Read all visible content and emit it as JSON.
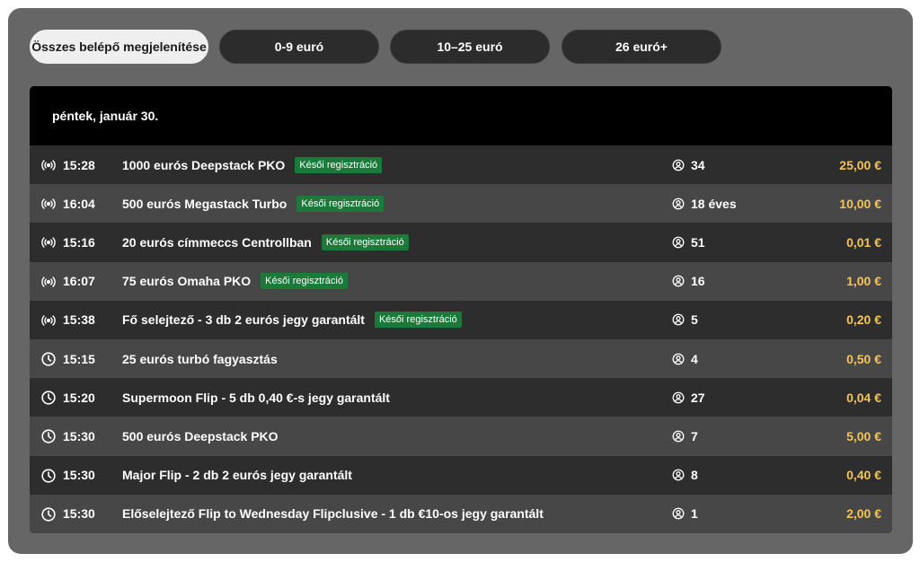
{
  "filters": [
    {
      "label": "Összes belépő megjelenítése",
      "active": true
    },
    {
      "label": "0-9 euró",
      "active": false
    },
    {
      "label": "10–25 euró",
      "active": false
    },
    {
      "label": "26 euró+",
      "active": false
    }
  ],
  "date_header": "péntek, január 30.",
  "late_reg_label": "Késői regisztráció",
  "rows": [
    {
      "status_icon": "live-broadcast-icon",
      "time": "15:28",
      "name": "1000 eurós Deepstack PKO",
      "late_reg": true,
      "players": "34",
      "price": "25,00 €"
    },
    {
      "status_icon": "live-broadcast-icon",
      "time": "16:04",
      "name": "500 eurós Megastack Turbo",
      "late_reg": true,
      "players": "18 éves",
      "price": "10,00 €"
    },
    {
      "status_icon": "live-broadcast-icon",
      "time": "15:16",
      "name": "20 eurós címmeccs Centrollban",
      "late_reg": true,
      "players": "51",
      "price": "0,01 €"
    },
    {
      "status_icon": "live-broadcast-icon",
      "time": "16:07",
      "name": "75 eurós Omaha PKO",
      "late_reg": true,
      "players": "16",
      "price": "1,00 €"
    },
    {
      "status_icon": "live-broadcast-icon",
      "time": "15:38",
      "name": "Fő selejtező - 3 db 2 eurós jegy garantált",
      "late_reg": true,
      "players": "5",
      "price": "0,20 €"
    },
    {
      "status_icon": "clock-icon",
      "time": "15:15",
      "name": "25 eurós turbó fagyasztás",
      "late_reg": false,
      "players": "4",
      "price": "0,50 €"
    },
    {
      "status_icon": "clock-icon",
      "time": "15:20",
      "name": "Supermoon Flip - 5 db 0,40 €-s jegy garantált",
      "late_reg": false,
      "players": "27",
      "price": "0,04 €"
    },
    {
      "status_icon": "clock-icon",
      "time": "15:30",
      "name": "500 eurós Deepstack PKO",
      "late_reg": false,
      "players": "7",
      "price": "5,00 €"
    },
    {
      "status_icon": "clock-icon",
      "time": "15:30",
      "name": "Major Flip - 2 db 2 eurós jegy garantált",
      "late_reg": false,
      "players": "8",
      "price": "0,40 €"
    },
    {
      "status_icon": "clock-icon",
      "time": "15:30",
      "name": "Előselejtező Flip to Wednesday Flipclusive - 1 db €10-os jegy garantált",
      "late_reg": false,
      "players": "1",
      "price": "2,00 €"
    }
  ],
  "colors": {
    "panel_bg": "#666666",
    "price": "#f5c451",
    "badge_bg": "#1b7a3a",
    "row_dark": "#2d2d2d",
    "row_light": "#474747",
    "header_bg": "#000000"
  }
}
